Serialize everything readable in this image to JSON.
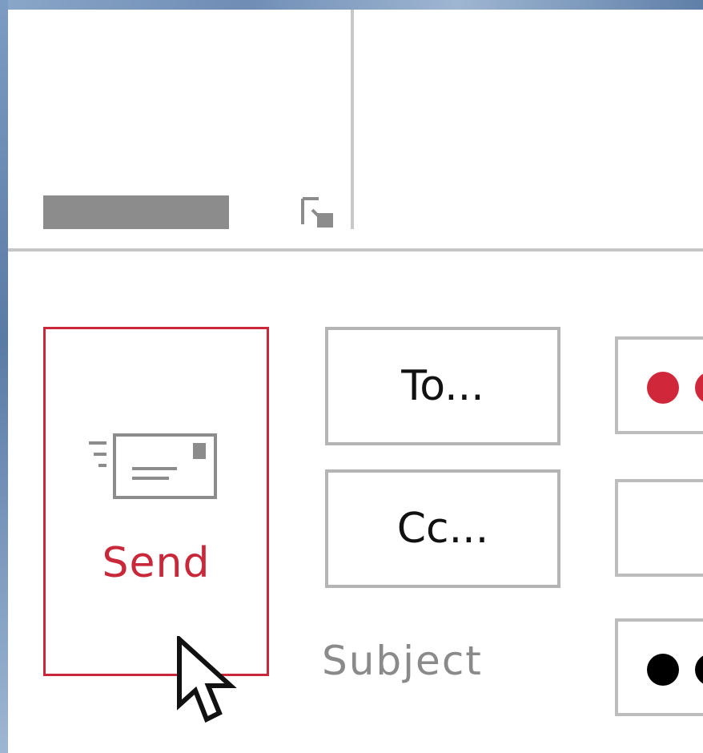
{
  "send": {
    "label": "Send"
  },
  "recipients": {
    "to_label": "To...",
    "cc_label": "Cc..."
  },
  "subject": {
    "label": "Subject"
  },
  "fields": {
    "to_dots_color": "#d0283a",
    "subject_dots_color": "#000000"
  },
  "colors": {
    "accent": "#c8283a",
    "border_gray": "#b4b4b4",
    "label_gray": "#8a8a8a"
  },
  "icons": {
    "send": "envelope-send-icon",
    "launcher": "dialog-launcher-icon",
    "cursor": "mouse-pointer-icon"
  }
}
